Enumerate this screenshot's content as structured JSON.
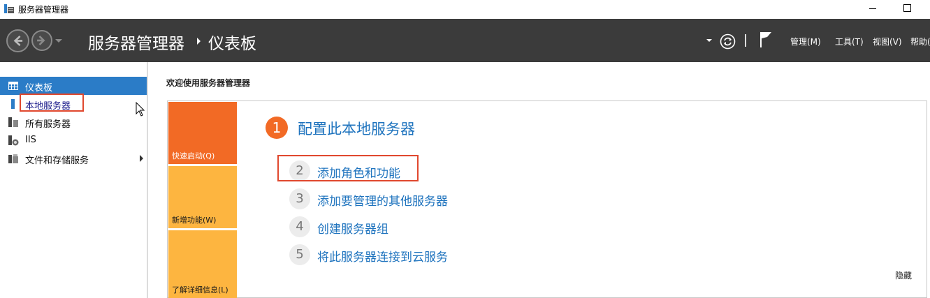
{
  "window": {
    "title": "服务器管理器"
  },
  "header": {
    "breadcrumb_root": "服务器管理器",
    "breadcrumb_current": "仪表板",
    "menu": {
      "manage": "管理(M)",
      "tools": "工具(T)",
      "view": "视图(V)",
      "help": "帮助("
    }
  },
  "sidebar": {
    "items": [
      {
        "label": "仪表板",
        "icon": "dashboard-icon",
        "active": true
      },
      {
        "label": "本地服务器",
        "icon": "local-server-icon",
        "highlighted": true
      },
      {
        "label": "所有服务器",
        "icon": "all-servers-icon"
      },
      {
        "label": "IIS",
        "icon": "iis-icon"
      },
      {
        "label": "文件和存储服务",
        "icon": "file-storage-icon",
        "has_submenu": true
      }
    ]
  },
  "main": {
    "welcome": "欢迎使用服务器管理器",
    "tiles": {
      "quick_start": "快速启动(Q)",
      "whats_new": "新增功能(W)",
      "learn_more": "了解详细信息(L)"
    },
    "steps": [
      {
        "num": "1",
        "label": "配置此本地服务器"
      },
      {
        "num": "2",
        "label": "添加角色和功能"
      },
      {
        "num": "3",
        "label": "添加要管理的其他服务器"
      },
      {
        "num": "4",
        "label": "创建服务器组"
      },
      {
        "num": "5",
        "label": "将此服务器连接到云服务"
      }
    ],
    "hide": "隐藏"
  },
  "colors": {
    "header_bg": "#3b3b3b",
    "accent_blue": "#2b7cc7",
    "link_blue": "#1e73be",
    "tile_orange": "#f26a25",
    "tile_yellow": "#fdb540",
    "highlight_red": "#e0482e"
  }
}
